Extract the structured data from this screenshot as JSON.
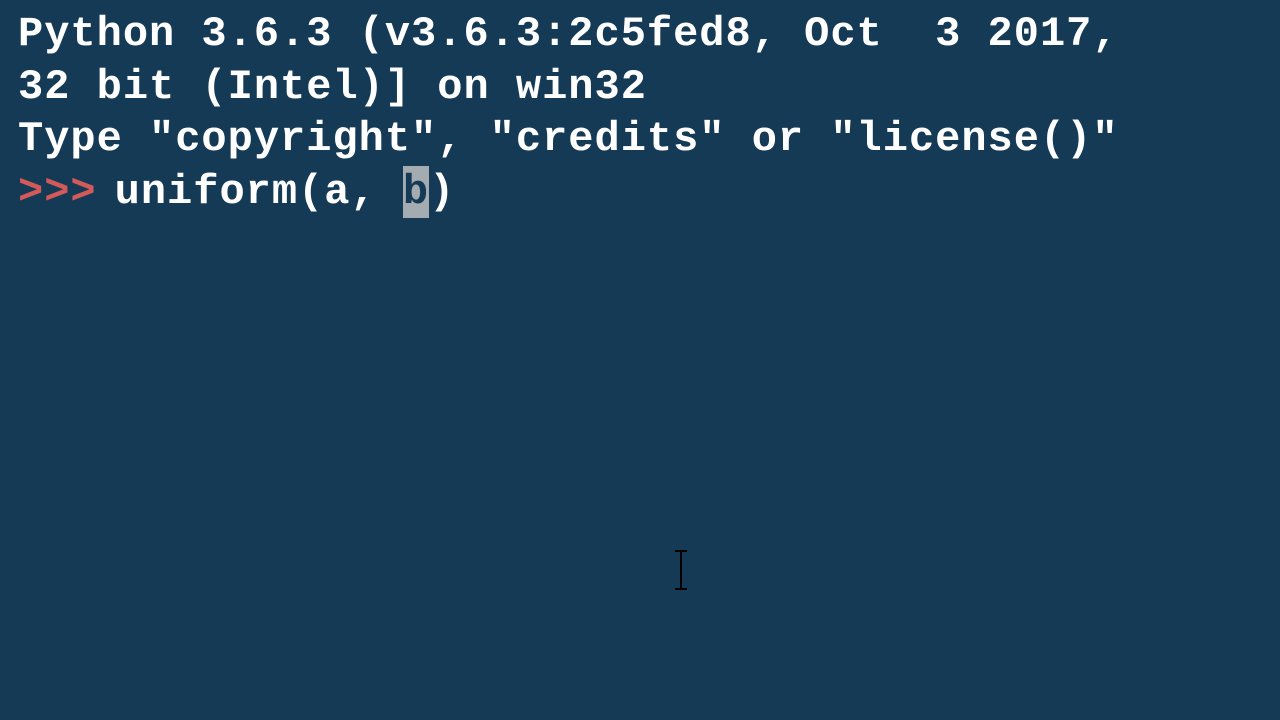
{
  "banner": {
    "line1": "Python 3.6.3 (v3.6.3:2c5fed8, Oct  3 2017,",
    "line2": "32 bit (Intel)] on win32",
    "line3": "Type \"copyright\", \"credits\" or \"license()\""
  },
  "repl": {
    "prompt": ">>>",
    "input_before_cursor": "uniform(a, ",
    "cursor_char": "b",
    "input_after_cursor": ")"
  }
}
